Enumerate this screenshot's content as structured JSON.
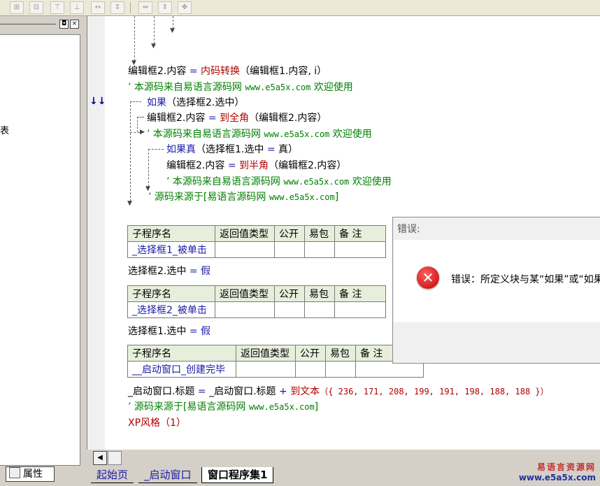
{
  "toolbar": {
    "icons": [
      "align-left-icon",
      "align-center-icon",
      "align-top-icon",
      "align-middle-icon",
      "same-width-icon",
      "same-height-icon",
      "h-space-icon",
      "v-space-icon",
      "center-icon"
    ]
  },
  "left_panel": {
    "close_glyph": "×",
    "restore_glyph": "◘",
    "truncated_text": "表",
    "property_tab_label": "属性"
  },
  "code": {
    "line1": {
      "a": "编辑框2.内容",
      "op": "=",
      "fn": "内码转换",
      "args": "（编辑框1.内容, i）"
    },
    "line2": {
      "prefix": "’ 本源码来自易语言源码网 ",
      "url": "www.e5a5x.com",
      "suffix": "  欢迎使用"
    },
    "line3": {
      "kw": "如果",
      "args": "（选择框2.选中）"
    },
    "line4": {
      "a": "编辑框2.内容",
      "op": "=",
      "fn": "到全角",
      "args": "（编辑框2.内容）"
    },
    "line5": {
      "prefix": "’ 本源码来自易语言源码网 ",
      "url": "www.e5a5x.com",
      "suffix": "  欢迎使用"
    },
    "line6": {
      "kw": "如果真",
      "args": "（选择框1.选中 ",
      "op": "=",
      "val": " 真）"
    },
    "line7": {
      "a": "编辑框2.内容",
      "op": "=",
      "fn": "到半角",
      "args": "（编辑框2.内容）"
    },
    "line8": {
      "prefix": "’ 本源码来自易语言源码网 ",
      "url": "www.e5a5x.com",
      "suffix": "  欢迎使用"
    },
    "line9": {
      "prefix": "’ 源码来源于[易语言源码网 ",
      "url": "www.e5a5x.com",
      "suffix": "]"
    },
    "assign1": {
      "a": "选择框2.选中",
      "op": "=",
      "val": "假"
    },
    "assign2": {
      "a": "选择框1.选中",
      "op": "=",
      "val": "假"
    },
    "line_title": {
      "a": "_启动窗口.标题",
      "op": "=",
      "b": "_启动窗口.标题",
      "plus": "+",
      "fn": "到文本",
      "args": "（{ 236, 171, 208, 199, 191, 198, 188, 188 }）"
    },
    "line_src": {
      "prefix": "’ 源码来源于[易语言源码网 ",
      "url": "www.e5a5x.com",
      "suffix": "]"
    },
    "line_xp": {
      "fn": "XP风格",
      "args": "（1）"
    }
  },
  "sub_tables": {
    "headers": {
      "name": "子程序名",
      "ret": "返回值类型",
      "pub": "公开",
      "easy": "易包",
      "note": "备 注"
    },
    "names": [
      "_选择框1_被单击",
      "_选择框2_被单击",
      "__启动窗口_创建完毕"
    ]
  },
  "margin_marker": "↓↓+",
  "tabs": {
    "start": "起始页",
    "window": "_启动窗口",
    "set": "窗口程序集1"
  },
  "dialog": {
    "title": "错误:",
    "message": "错误：所定义块与某“如果”或“如果真",
    "icon": "error-icon"
  },
  "watermark": {
    "top": "易语言资源网",
    "bottom": "www.e5a5x.com"
  }
}
